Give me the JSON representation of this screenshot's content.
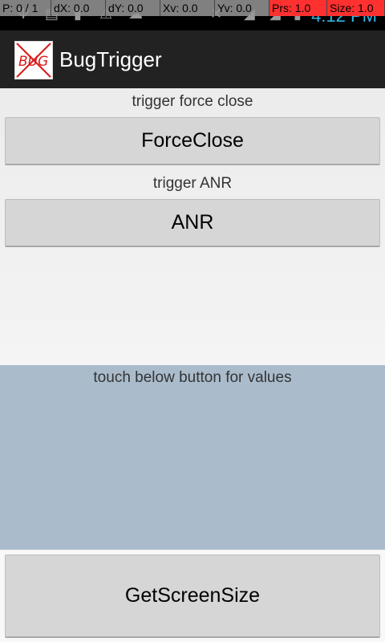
{
  "status_bar": {
    "pointer_location": [
      "P: 0 / 1",
      "dX: 0.0",
      "dY: 0.0",
      "Xv: 0.0",
      "Yv: 0.0",
      "Prs: 1.0",
      "Size: 1.0"
    ],
    "clock": "4:12 PM",
    "icons": [
      "usb-icon",
      "sd-card-icon",
      "battery-saver-icon",
      "warning-icon",
      "cloud-icon",
      "no-sim-icon",
      "signal-icon",
      "wifi-icon",
      "battery-icon"
    ]
  },
  "action_bar": {
    "title": "BugTrigger",
    "icon_text": "BUG"
  },
  "content": {
    "force_close_label": "trigger force close",
    "force_close_button": "ForceClose",
    "anr_label": "trigger ANR",
    "anr_button": "ANR",
    "panel_text": "touch below button for values",
    "panel_color": "#aabccc",
    "screen_size_button": "GetScreenSize"
  }
}
